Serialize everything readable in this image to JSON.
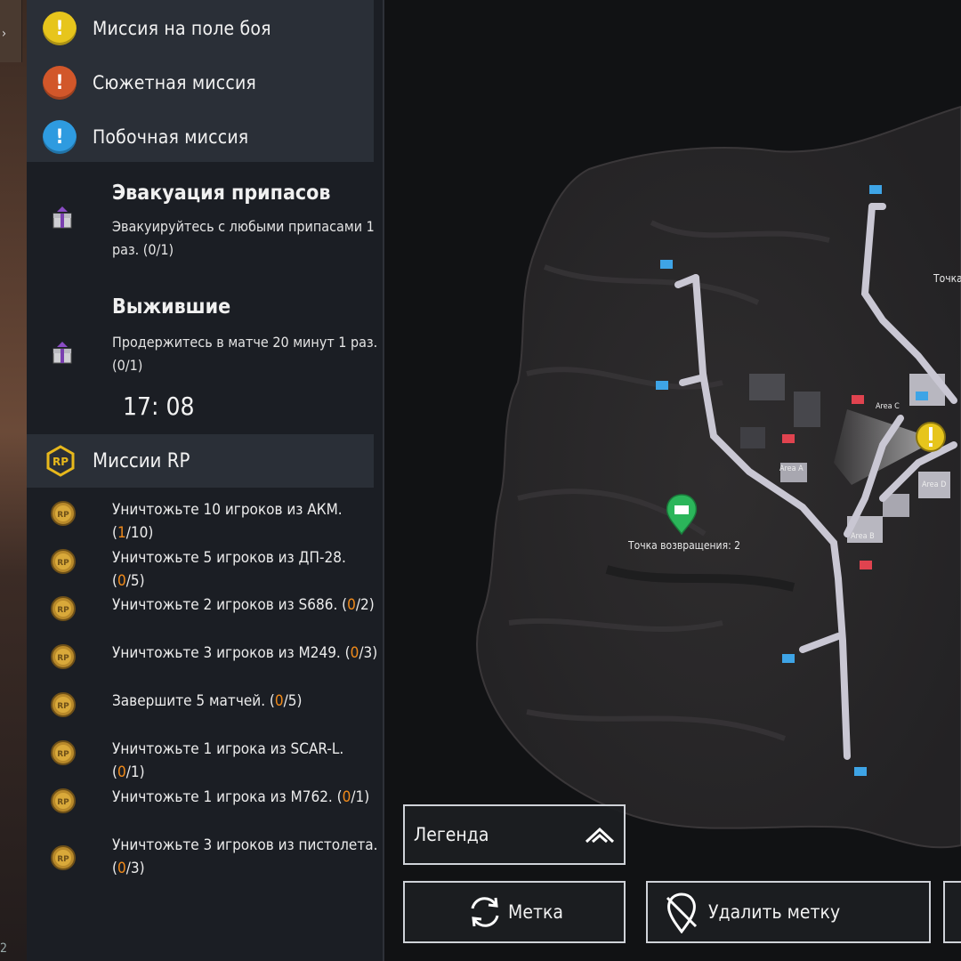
{
  "legend_types": [
    {
      "label": "Миссия на поле боя",
      "icon": "yellow-exclamation-icon",
      "color": "#e7c51c",
      "glyph": "!"
    },
    {
      "label": "Сюжетная миссия",
      "icon": "orange-exclamation-icon",
      "color": "#d2572a",
      "glyph": "!"
    },
    {
      "label": "Побочная миссия",
      "icon": "blue-exclamation-icon",
      "color": "#2e9be0",
      "glyph": "!"
    }
  ],
  "missions": [
    {
      "title": "Эвакуация припасов",
      "desc": "Эвакуируйтесь с любыми припасами 1 раз. (0/1)",
      "icon": "supply-crate-icon"
    },
    {
      "title": "Выжившие",
      "desc": "Продержитесь в матче 20 минут 1 раз. (0/1)",
      "icon": "supply-crate-icon"
    }
  ],
  "timer": "17: 08",
  "rp": {
    "title": "Миссии RP",
    "badge": "RP",
    "tasks": [
      {
        "pre": "Уничтожьте 10 игроков из АКМ. (",
        "progress": "1",
        "post": "/10)"
      },
      {
        "pre": "Уничтожьте 5 игроков из ДП-28. (",
        "progress": "0",
        "post": "/5)"
      },
      {
        "pre": "Уничтожьте 2 игроков из S686. (",
        "progress": "0",
        "post": "/2)"
      },
      {
        "pre": "Уничтожьте 3 игроков из M249. (",
        "progress": "0",
        "post": "/3)"
      },
      {
        "pre": "Завершите 5 матчей. (",
        "progress": "0",
        "post": "/5)"
      },
      {
        "pre": "Уничтожьте 1 игрока из SCAR-L. (",
        "progress": "0",
        "post": "/1)"
      },
      {
        "pre": "Уничтожьте 1 игрока из M762. (",
        "progress": "0",
        "post": "/1)"
      },
      {
        "pre": "Уничтожьте 3 игроков из пистолета. (",
        "progress": "0",
        "post": "/3)"
      }
    ]
  },
  "map": {
    "return_point": "Точка возвращения: 2",
    "point_partial": "Точка",
    "areas": [
      "Area C",
      "Area A",
      "Area D",
      "Area B"
    ]
  },
  "buttons": {
    "legend": "Легенда",
    "mark": "Метка",
    "delete_mark": "Удалить метку"
  },
  "footer": {
    "num": "2"
  },
  "colors": {
    "panel": "#1b1e24",
    "header": "#2a2f37",
    "progress": "#f08a1a",
    "road": "#c9c7d3"
  }
}
